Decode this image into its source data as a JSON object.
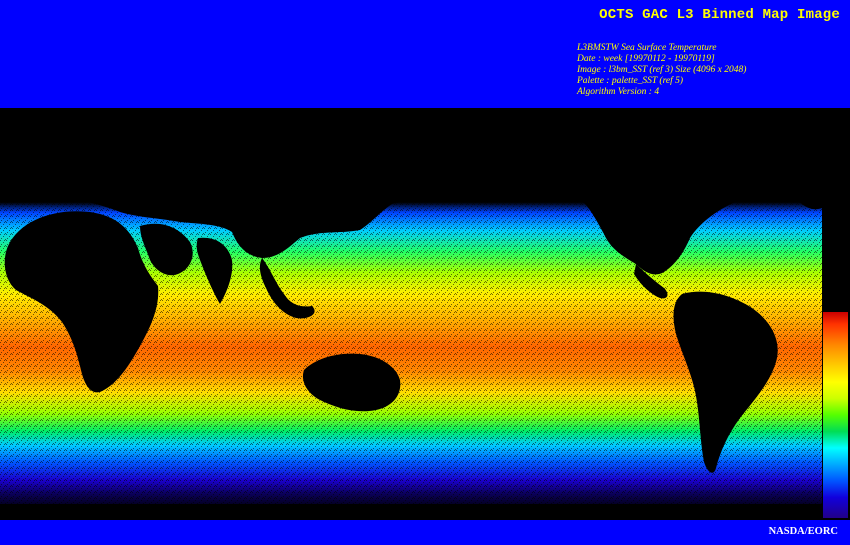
{
  "header": {
    "title": "OCTS GAC L3 Binned Map Image",
    "info_lines": [
      "L3BMSTW Sea Surface Temperature",
      "Date : week [19970112 - 19970119]",
      "Image : l3bm_SST (ref 3) Size (4096 x 2048)",
      "Palette : palette_SST (ref 5)",
      "Algorithm Version : 4"
    ]
  },
  "map": {
    "variable": "Sea Surface Temperature",
    "projection": "equirectangular",
    "land_color": "#000000",
    "colorbar": {
      "orientation": "vertical",
      "high_color": "#cc0000",
      "low_color": "#220088"
    }
  },
  "footer": {
    "credit": "NASDA/EORC"
  },
  "colors": {
    "band_background": "#0000ff",
    "title_color": "#ffff00",
    "credit_color": "#ffffff"
  }
}
